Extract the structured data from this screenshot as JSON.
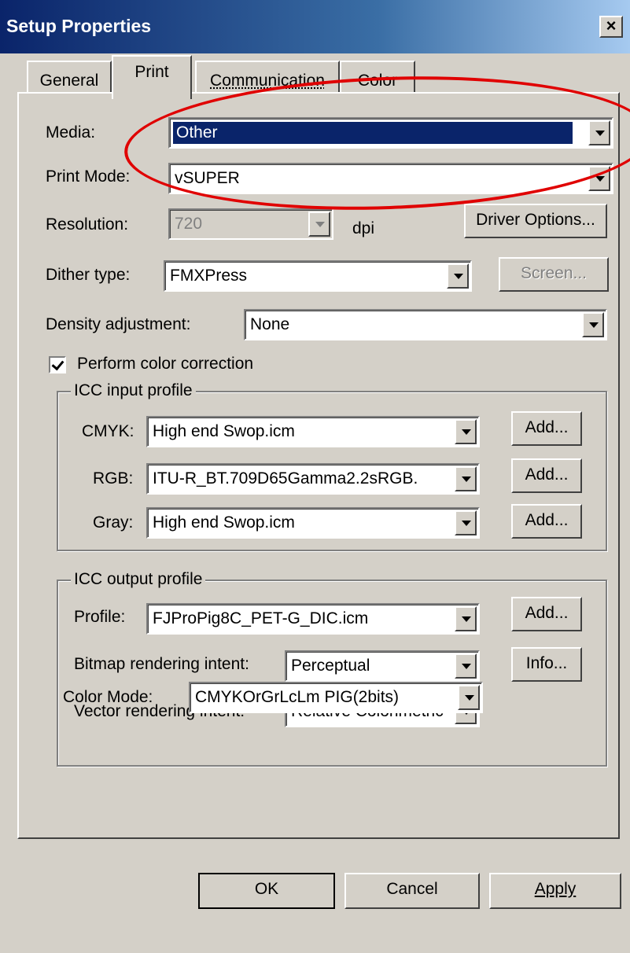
{
  "window": {
    "title": "Setup Properties",
    "close_label": "×"
  },
  "tabs": [
    {
      "label": "General",
      "active": false
    },
    {
      "label": "Print",
      "active": true
    },
    {
      "label": "Communication",
      "active": false
    },
    {
      "label": "Color",
      "active": false
    }
  ],
  "print": {
    "media": {
      "label": "Media:",
      "value": "Other"
    },
    "print_mode": {
      "label": "Print Mode:",
      "value": "vSUPER"
    },
    "resolution": {
      "label": "Resolution:",
      "value": "720",
      "unit": "dpi"
    },
    "driver_options_label": "Driver Options...",
    "dither": {
      "label": "Dither type:",
      "value": "FMXPress"
    },
    "screen_label": "Screen...",
    "density": {
      "label": "Density adjustment:",
      "value": "None"
    },
    "color_correction": {
      "label": "Perform color correction",
      "checked": true
    }
  },
  "icc_input": {
    "title": "ICC input profile",
    "cmyk": {
      "label": "CMYK:",
      "value": "High end Swop.icm"
    },
    "rgb": {
      "label": "RGB:",
      "value": "ITU-R_BT.709D65Gamma2.2sRGB."
    },
    "gray": {
      "label": "Gray:",
      "value": "High end Swop.icm"
    },
    "add_label": "Add..."
  },
  "icc_output": {
    "title": "ICC output profile",
    "profile": {
      "label": "Profile:",
      "value": "FJProPig8C_PET-G_DIC.icm"
    },
    "bitmap_intent": {
      "label": "Bitmap rendering intent:",
      "value": "Perceptual"
    },
    "vector_intent": {
      "label": "Vector rendering intent:",
      "value": "Relative Colorimetric"
    },
    "add_label": "Add...",
    "info_label": "Info..."
  },
  "color_mode": {
    "label": "Color Mode:",
    "value": "CMYKOrGrLcLm PIG(2bits)"
  },
  "buttons": {
    "ok": "OK",
    "cancel": "Cancel",
    "apply": "Apply"
  },
  "colors": {
    "title_bar": "#0a246a",
    "dialog_face": "#d4d0c8",
    "selection": "#0a246a",
    "annotation": "#e00000"
  }
}
